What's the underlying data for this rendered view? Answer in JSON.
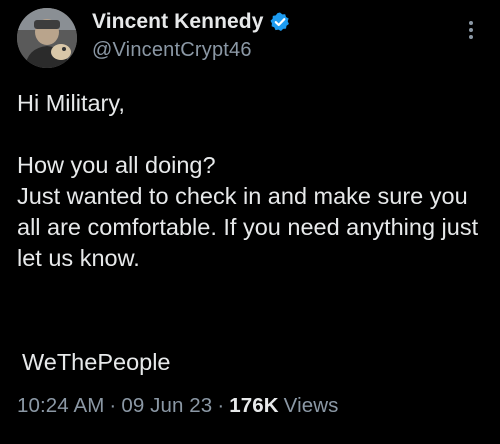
{
  "author": {
    "display_name": "Vincent Kennedy",
    "handle": "@VincentCrypt46",
    "verified": true,
    "verified_color": "#1d9bf0",
    "avatar_icon": "profile-photo"
  },
  "menu": {
    "icon": "more-vertical-icon"
  },
  "tweet": {
    "text": "Hi Military,\n\nHow you all doing?\nJust wanted to check in and make sure you all are comfortable. If you need anything just let us know.",
    "hashtag_line": "WeThePeople"
  },
  "meta": {
    "time": "10:24 AM",
    "separator": "·",
    "date": "09 Jun 23",
    "views_count": "176K",
    "views_label": "Views"
  },
  "colors": {
    "background": "#000000",
    "primary_text": "#e7e9ea",
    "secondary_text": "#8b98a5"
  }
}
